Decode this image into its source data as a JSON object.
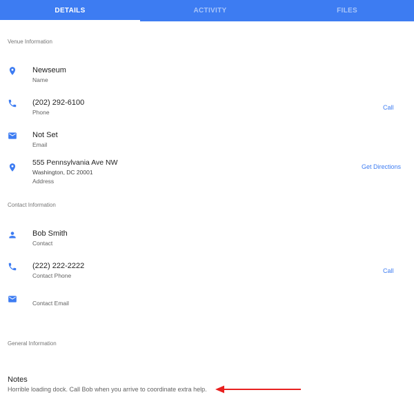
{
  "tabs": [
    {
      "label": "DETAILS",
      "active": true
    },
    {
      "label": "ACTIVITY",
      "active": false
    },
    {
      "label": "FILES",
      "active": false
    }
  ],
  "venue": {
    "section_title": "Venue Information",
    "name": {
      "value": "Newseum",
      "label": "Name"
    },
    "phone": {
      "value": "(202) 292-6100",
      "label": "Phone",
      "action": "Call"
    },
    "email": {
      "value": "Not Set",
      "label": "Email"
    },
    "address": {
      "line1": "555 Pennsylvania Ave NW",
      "line2": "Washington, DC 20001",
      "label": "Address",
      "action": "Get Directions"
    }
  },
  "contact": {
    "section_title": "Contact Information",
    "name": {
      "value": "Bob Smith",
      "label": "Contact"
    },
    "phone": {
      "value": "(222) 222-2222",
      "label": "Contact Phone",
      "action": "Call"
    },
    "email": {
      "label": "Contact Email"
    }
  },
  "general": {
    "section_title": "General Information",
    "notes_title": "Notes",
    "notes_text": "Horrible loading dock. Call Bob when you arrive to coordinate extra help."
  },
  "colors": {
    "accent": "#3d7cf2",
    "annotation_arrow": "#e8201f"
  },
  "icons": [
    "place-icon",
    "phone-icon",
    "email-icon",
    "person-icon"
  ]
}
